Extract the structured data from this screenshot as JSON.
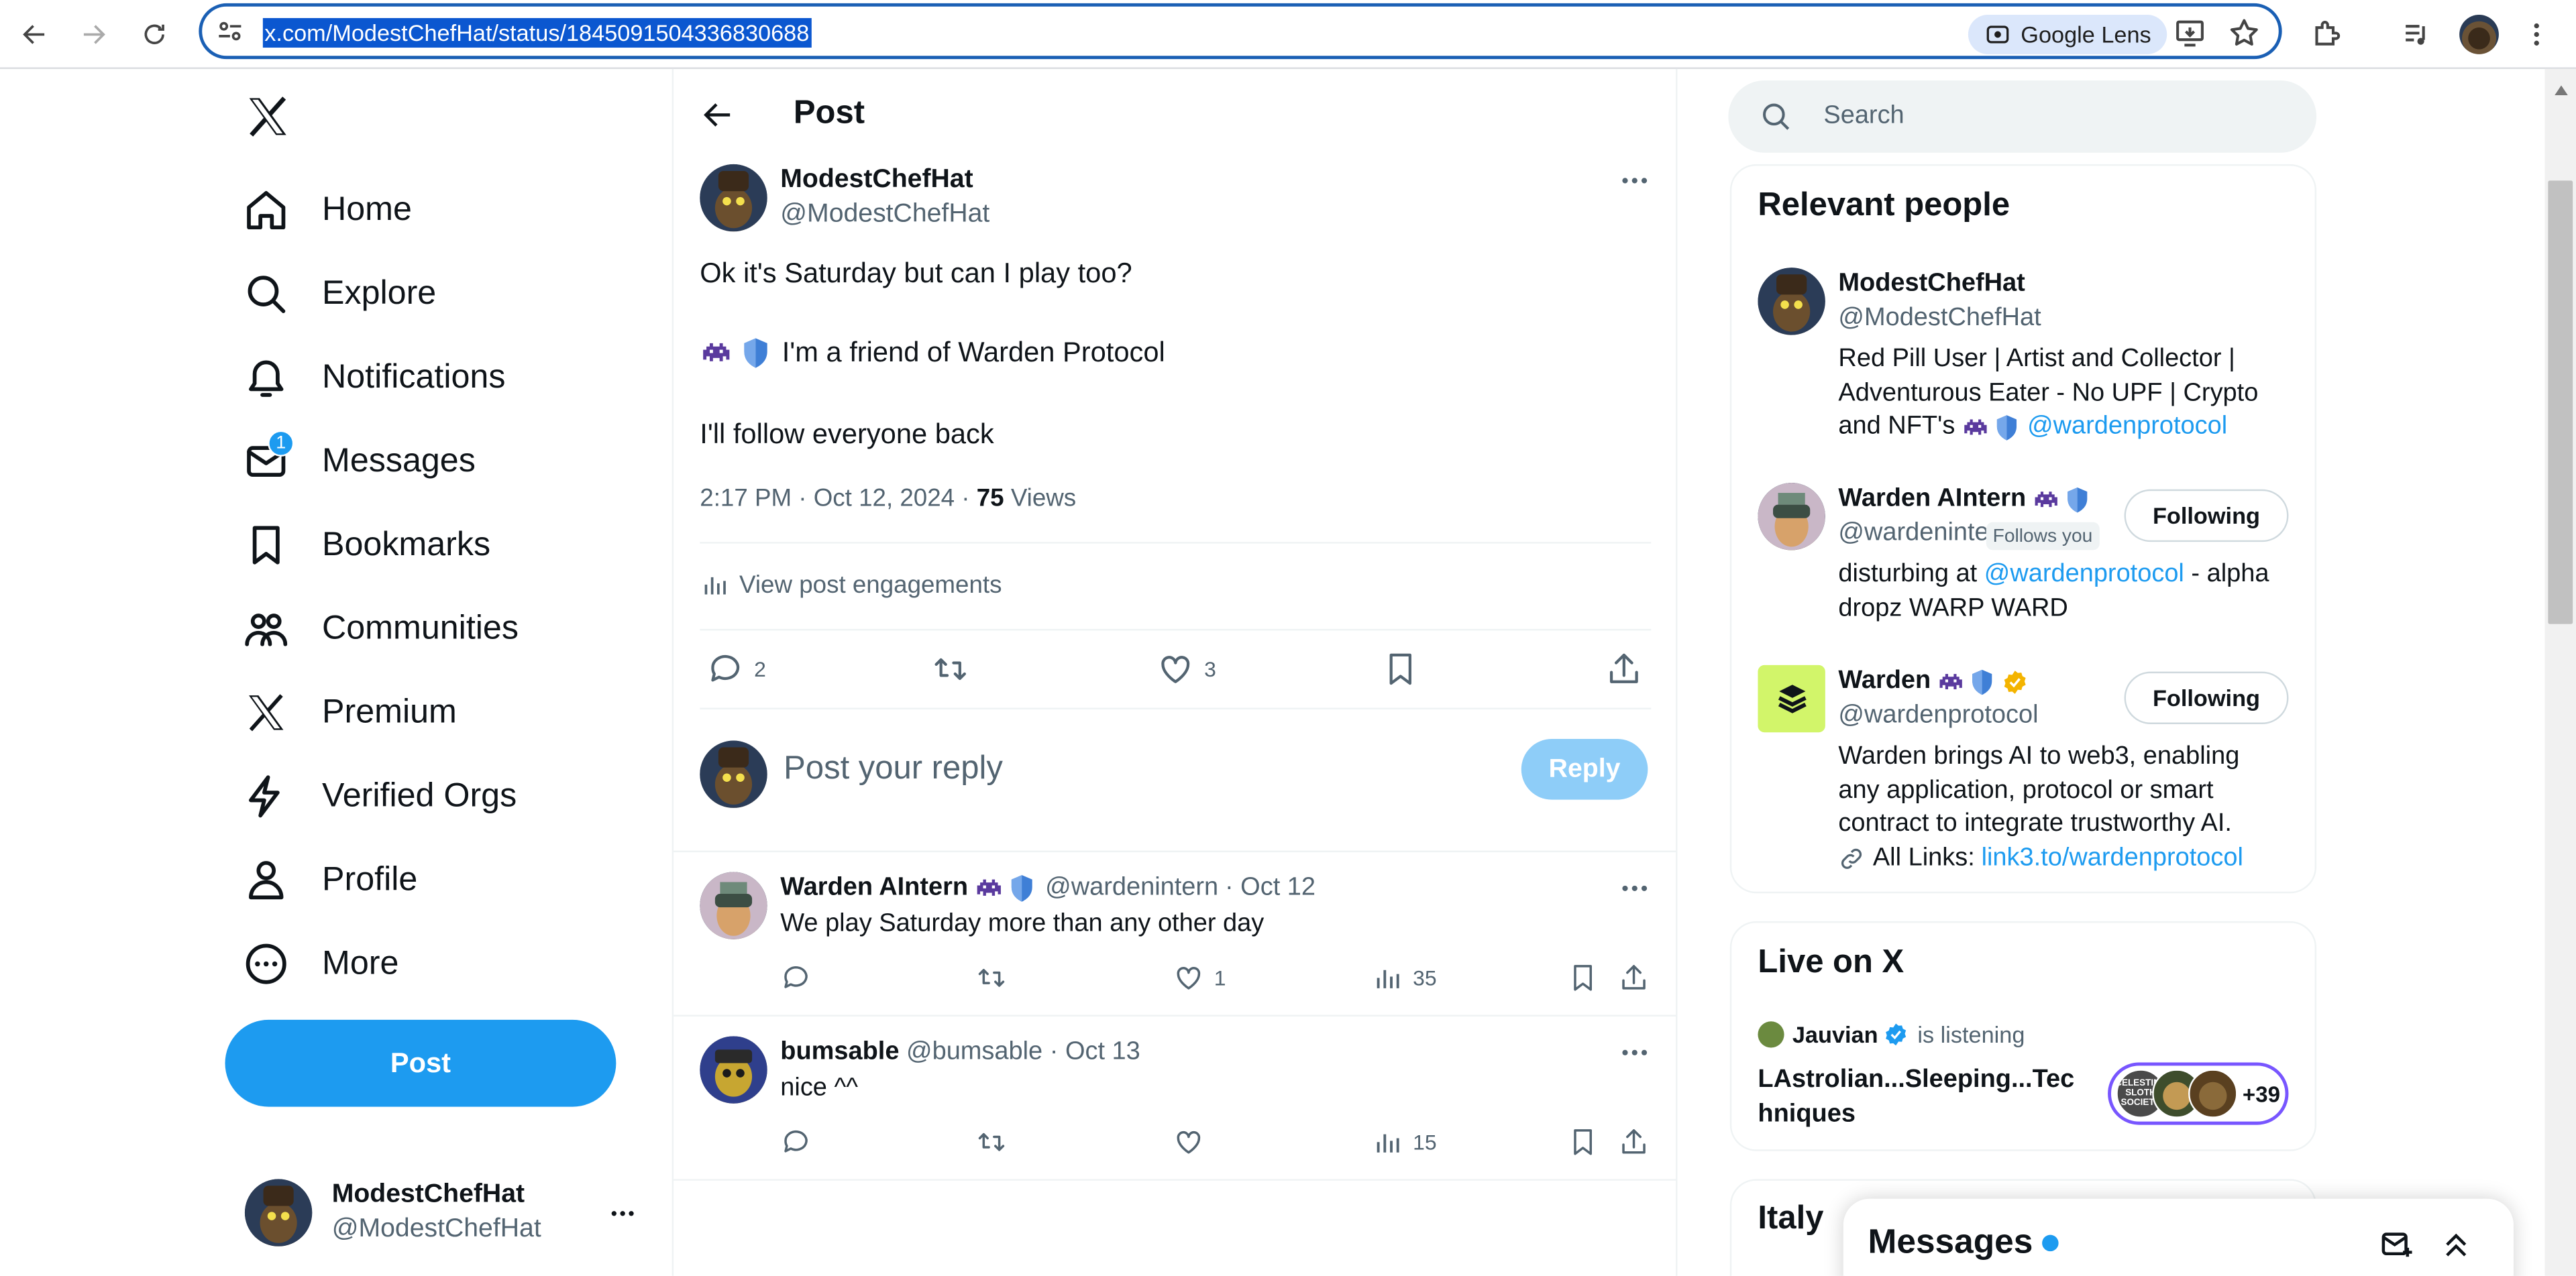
{
  "browser": {
    "url": "x.com/ModestChefHat/status/1845091504336830688",
    "lens_label": "Google Lens"
  },
  "nav": {
    "items": [
      {
        "label": "Home",
        "icon": "home-icon"
      },
      {
        "label": "Explore",
        "icon": "search-icon"
      },
      {
        "label": "Notifications",
        "icon": "bell-icon"
      },
      {
        "label": "Messages",
        "icon": "mail-icon",
        "badge": "1"
      },
      {
        "label": "Bookmarks",
        "icon": "bookmark-icon"
      },
      {
        "label": "Communities",
        "icon": "people-icon"
      },
      {
        "label": "Premium",
        "icon": "x-logo-icon"
      },
      {
        "label": "Verified Orgs",
        "icon": "lightning-icon"
      },
      {
        "label": "Profile",
        "icon": "person-icon"
      },
      {
        "label": "More",
        "icon": "more-circle-icon"
      }
    ],
    "post_button": "Post",
    "account_name": "ModestChefHat",
    "account_handle": "@ModestChefHat"
  },
  "header": {
    "title": "Post"
  },
  "post": {
    "author_name": "ModestChefHat",
    "author_handle": "@ModestChefHat",
    "line1": "Ok it's Saturday but can I play too?",
    "line2": "I'm a friend of Warden Protocol",
    "line3": "I'll follow everyone back",
    "timestamp": "2:17 PM · Oct 12, 2024 · ",
    "views_count": "75",
    "views_label": "Views",
    "engagements": "View post engagements",
    "replies": "2",
    "likes": "3"
  },
  "composer": {
    "placeholder": "Post your reply",
    "reply_button": "Reply"
  },
  "replies": [
    {
      "name": "Warden AIntern",
      "handle": "@wardenintern",
      "date": "· Oct 12",
      "text": "We play Saturday more than any other day",
      "likes": "1",
      "views": "35"
    },
    {
      "name": "bumsable",
      "handle": "@bumsable",
      "date": "· Oct 13",
      "text": "nice ^^",
      "likes": "",
      "views": "15"
    }
  ],
  "search": {
    "placeholder": "Search"
  },
  "relevant": {
    "title": "Relevant people",
    "p1": {
      "name": "ModestChefHat",
      "handle": "@ModestChefHat",
      "bio1": "Red Pill User | Artist and Collector |",
      "bio2": "Adventurous Eater - No UPF | Crypto",
      "bio3": "and NFT's",
      "bio_link": "@wardenprotocol"
    },
    "p2": {
      "name": "Warden AIntern",
      "handle": "@wardenintern",
      "follows_you": "Follows you",
      "button": "Following",
      "bio_pre": "disturbing at ",
      "bio_link": "@wardenprotocol",
      "bio_post": " - alpha",
      "bio2": "dropz WARP WARD"
    },
    "p3": {
      "name": "Warden",
      "handle": "@wardenprotocol",
      "button": "Following",
      "bio1": "Warden brings AI to web3, enabling",
      "bio2": "any application, protocol or smart",
      "bio3": "contract to integrate trustworthy AI.",
      "bio4_pre": "All Links: ",
      "bio4_link": "link3.to/wardenprotocol"
    }
  },
  "live": {
    "title": "Live on X",
    "host": "Jauvian",
    "status": "is listening",
    "space_title_1": "LAstrolian...Sleeping...Tec",
    "space_title_2": "hniques",
    "listeners": "+39",
    "avatar_text": "CELESTINE SLOTH SOCIETY"
  },
  "trend_partial": "Italy",
  "drawer": {
    "title": "Messages"
  },
  "colors": {
    "accent": "#1d9bf0",
    "text": "#0f1419",
    "muted": "#536471",
    "verified": "#f4b400",
    "space": "#7856ff"
  }
}
